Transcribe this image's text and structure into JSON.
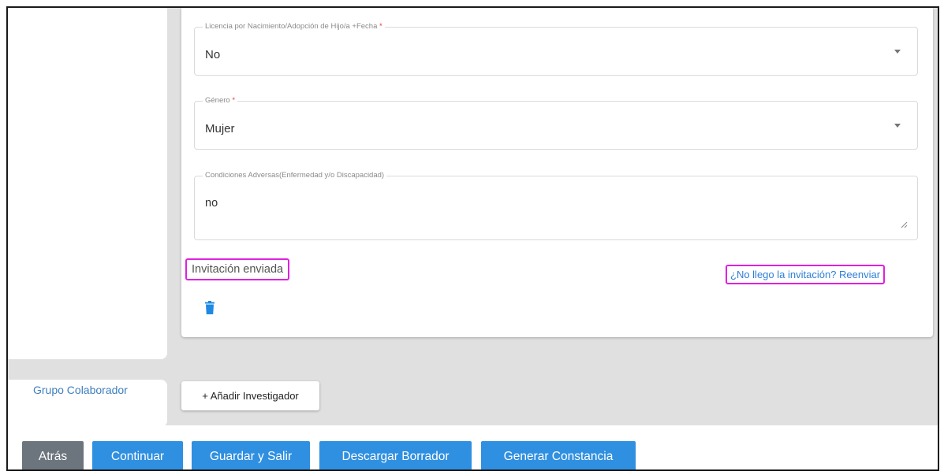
{
  "form": {
    "licencia": {
      "label": "Licencia por Nacimiento/Adopción de Hijo/a +Fecha",
      "required_mark": "*",
      "value": "No"
    },
    "genero": {
      "label": "Género",
      "required_mark": "*",
      "value": "Mujer"
    },
    "condiciones": {
      "label": "Condiciones Adversas(Enfermedad y/o Discapacidad)",
      "value": "no"
    },
    "invitation_status": "Invitación enviada",
    "resend_link": "¿No llego la invitación? Reenviar"
  },
  "sidebar": {
    "group_label": "Grupo Colaborador"
  },
  "actions": {
    "add_researcher": "+ Añadir Investigador"
  },
  "footer": {
    "back": "Atrás",
    "continue": "Continuar",
    "save_exit": "Guardar y Salir",
    "download_draft": "Descargar Borrador",
    "generate_certificate": "Generar Constancia"
  },
  "colors": {
    "primary_button": "#2f8fe0",
    "secondary_button": "#6c757d",
    "highlight_border": "#e020e0",
    "link": "#2f7fd6",
    "required": "#e53935"
  },
  "icons": {
    "trash": "delete-icon",
    "dropdown": "chevron-down-icon",
    "resize": "resize-handle-icon"
  }
}
